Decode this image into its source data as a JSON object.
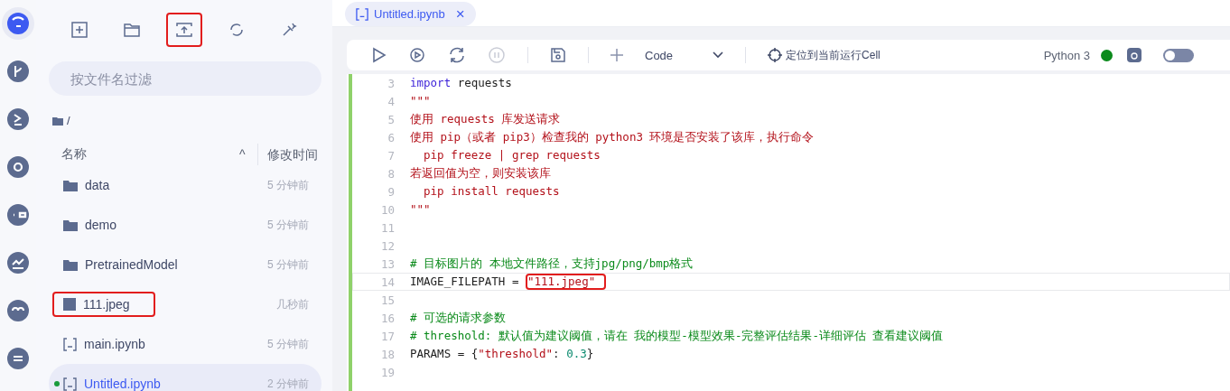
{
  "rail": [
    {
      "selected": true
    },
    {
      "selected": false
    },
    {
      "selected": false
    },
    {
      "selected": false
    },
    {
      "selected": false
    },
    {
      "selected": false
    },
    {
      "selected": false
    },
    {
      "selected": false
    }
  ],
  "file_toolbar": [
    {
      "highlighted": false
    },
    {
      "highlighted": false
    },
    {
      "highlighted": true
    },
    {
      "highlighted": false
    },
    {
      "highlighted": false
    }
  ],
  "filter": {
    "placeholder": "按文件名过滤"
  },
  "path": "/",
  "columns": {
    "name": "名称",
    "sort": "^",
    "modified": "修改时间"
  },
  "files": [
    {
      "kind": "folder",
      "name": "data",
      "time": "5 分钟前",
      "selected": false,
      "highlighted": false,
      "running": false
    },
    {
      "kind": "folder",
      "name": "demo",
      "time": "5 分钟前",
      "selected": false,
      "highlighted": false,
      "running": false
    },
    {
      "kind": "folder",
      "name": "PretrainedModel",
      "time": "5 分钟前",
      "selected": false,
      "highlighted": false,
      "running": false
    },
    {
      "kind": "image",
      "name": "111.jpeg",
      "time": "几秒前",
      "selected": false,
      "highlighted": true,
      "running": false
    },
    {
      "kind": "notebook",
      "name": "main.ipynb",
      "time": "5 分钟前",
      "selected": false,
      "highlighted": false,
      "running": false
    },
    {
      "kind": "notebook",
      "name": "Untitled.ipynb",
      "time": "2 分钟前",
      "selected": true,
      "highlighted": false,
      "running": true
    }
  ],
  "tab": {
    "title": "Untitled.ipynb",
    "close": "×"
  },
  "toolbar": {
    "cell_type": "Code",
    "locate": "定位到当前运行Cell",
    "kernel": "Python 3",
    "kernel_ok": true,
    "toggle_on": false
  },
  "code_lines": [
    {
      "number": "3",
      "active": false,
      "tokens": [
        {
          "kind": "keyword",
          "text": "import"
        },
        {
          "kind": "plain",
          "text": " requests"
        }
      ]
    },
    {
      "number": "4",
      "active": false,
      "tokens": [
        {
          "kind": "string",
          "text": "\"\"\""
        }
      ]
    },
    {
      "number": "5",
      "active": false,
      "tokens": [
        {
          "kind": "string",
          "text": "使用 requests 库发送请求"
        }
      ]
    },
    {
      "number": "6",
      "active": false,
      "tokens": [
        {
          "kind": "string",
          "text": "使用 pip（或者 pip3）检查我的 python3 环境是否安装了该库，执行命令"
        }
      ]
    },
    {
      "number": "7",
      "active": false,
      "tokens": [
        {
          "kind": "string",
          "text": "  pip freeze | grep requests"
        }
      ]
    },
    {
      "number": "8",
      "active": false,
      "tokens": [
        {
          "kind": "string",
          "text": "若返回值为空，则安装该库"
        }
      ]
    },
    {
      "number": "9",
      "active": false,
      "tokens": [
        {
          "kind": "string",
          "text": "  pip install requests"
        }
      ]
    },
    {
      "number": "10",
      "active": false,
      "tokens": [
        {
          "kind": "string",
          "text": "\"\"\""
        }
      ]
    },
    {
      "number": "11",
      "active": false
    },
    {
      "number": "12",
      "active": false
    },
    {
      "number": "13",
      "active": false,
      "tokens": [
        {
          "kind": "comment",
          "text": "# 目标图片的 本地文件路径，支持jpg/png/bmp格式"
        }
      ]
    },
    {
      "number": "14",
      "active": true,
      "tokens": [
        {
          "kind": "plain",
          "text": "IMAGE_FILEPATH = "
        },
        {
          "kind": "string",
          "text": "\"111.jpeg\"",
          "highlighted": true
        }
      ]
    },
    {
      "number": "15",
      "active": false
    },
    {
      "number": "16",
      "active": false,
      "tokens": [
        {
          "kind": "comment",
          "text": "# 可选的请求参数"
        }
      ]
    },
    {
      "number": "17",
      "active": false,
      "tokens": [
        {
          "kind": "comment",
          "text": "# threshold: 默认值为建议阈值，请在 我的模型-模型效果-完整评估结果-详细评估 查看建议阈值"
        }
      ]
    },
    {
      "number": "18",
      "active": false,
      "tokens": [
        {
          "kind": "plain",
          "text": "PARAMS = {"
        },
        {
          "kind": "string",
          "text": "\"threshold\""
        },
        {
          "kind": "plain",
          "text": ": "
        },
        {
          "kind": "number",
          "text": "0.3"
        },
        {
          "kind": "plain",
          "text": "}"
        }
      ]
    },
    {
      "number": "19",
      "active": false
    }
  ]
}
